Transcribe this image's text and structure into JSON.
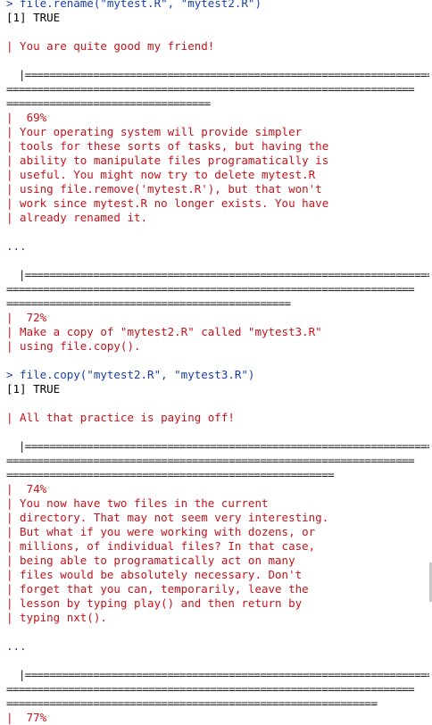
{
  "console": {
    "lines": [
      {
        "type": "cmd",
        "text": "> file.rename(\"mytest.R\", \"mytest2.R\")"
      },
      {
        "type": "out",
        "text": "[1] TRUE"
      },
      {
        "type": "gap",
        "text": ""
      },
      {
        "type": "msg",
        "text": "| You are quite good my friend!"
      },
      {
        "type": "gap",
        "text": ""
      },
      {
        "type": "bar",
        "text": "  |=================================================================="
      },
      {
        "type": "bar",
        "text": "=================================================================="
      },
      {
        "type": "bar",
        "text": "================================="
      },
      {
        "type": "msg",
        "text": "|  69%"
      },
      {
        "type": "msg",
        "text": "| Your operating system will provide simpler"
      },
      {
        "type": "msg",
        "text": "| tools for these sorts of tasks, but having the"
      },
      {
        "type": "msg",
        "text": "| ability to manipulate files programatically is"
      },
      {
        "type": "msg",
        "text": "| useful. You might now try to delete mytest.R"
      },
      {
        "type": "msg",
        "text": "| using file.remove('mytest.R'), but that won't"
      },
      {
        "type": "msg",
        "text": "| work since mytest.R no longer exists. You have"
      },
      {
        "type": "msg",
        "text": "| already renamed it."
      },
      {
        "type": "gap",
        "text": ""
      },
      {
        "type": "cmd",
        "text": "..."
      },
      {
        "type": "gap",
        "text": ""
      },
      {
        "type": "bar",
        "text": "  |=================================================================="
      },
      {
        "type": "bar",
        "text": "=================================================================="
      },
      {
        "type": "bar",
        "text": "=============================================="
      },
      {
        "type": "msg",
        "text": "|  72%"
      },
      {
        "type": "msg",
        "text": "| Make a copy of \"mytest2.R\" called \"mytest3.R\""
      },
      {
        "type": "msg",
        "text": "| using file.copy()."
      },
      {
        "type": "gap",
        "text": ""
      },
      {
        "type": "cmd",
        "text": "> file.copy(\"mytest2.R\", \"mytest3.R\")"
      },
      {
        "type": "out",
        "text": "[1] TRUE"
      },
      {
        "type": "gap",
        "text": ""
      },
      {
        "type": "msg",
        "text": "| All that practice is paying off!"
      },
      {
        "type": "gap",
        "text": ""
      },
      {
        "type": "bar",
        "text": "  |=================================================================="
      },
      {
        "type": "bar",
        "text": "=================================================================="
      },
      {
        "type": "bar",
        "text": "====================================================="
      },
      {
        "type": "msg",
        "text": "|  74%"
      },
      {
        "type": "msg",
        "text": "| You now have two files in the current"
      },
      {
        "type": "msg",
        "text": "| directory. That may not seem very interesting."
      },
      {
        "type": "msg",
        "text": "| But what if you were working with dozens, or"
      },
      {
        "type": "msg",
        "text": "| millions, of individual files? In that case,"
      },
      {
        "type": "msg",
        "text": "| being able to programatically act on many"
      },
      {
        "type": "msg",
        "text": "| files would be absolutely necessary. Don't"
      },
      {
        "type": "msg",
        "text": "| forget that you can, temporarily, leave the"
      },
      {
        "type": "msg",
        "text": "| lesson by typing play() and then return by"
      },
      {
        "type": "msg",
        "text": "| typing nxt()."
      },
      {
        "type": "gap",
        "text": ""
      },
      {
        "type": "cmd",
        "text": "..."
      },
      {
        "type": "gap",
        "text": ""
      },
      {
        "type": "bar",
        "text": "  |=================================================================="
      },
      {
        "type": "bar",
        "text": "=================================================================="
      },
      {
        "type": "bar",
        "text": "============================================================"
      },
      {
        "type": "msg",
        "text": "|  77%"
      }
    ]
  }
}
